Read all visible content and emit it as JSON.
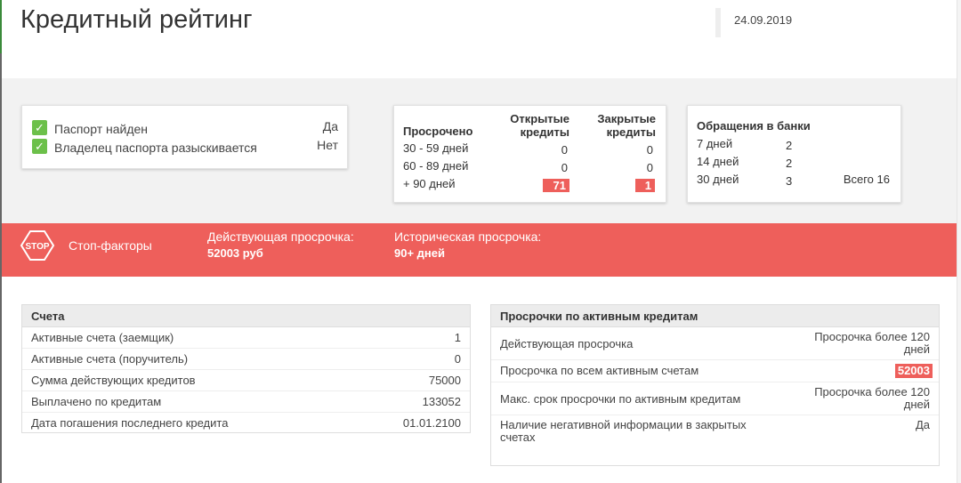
{
  "header": {
    "title": "Кредитный рейтинг",
    "date": "24.09.2019"
  },
  "passport": [
    {
      "label": "Паспорт найден",
      "value": "Да"
    },
    {
      "label": "Владелец паспорта разыскивается",
      "value": "Нет"
    }
  ],
  "overdue": {
    "title": "Просрочено",
    "col_open": "Открытые кредиты",
    "col_closed": "Закрытые кредиты",
    "rows": [
      {
        "label": "30 - 59 дней",
        "open": "0",
        "closed": "0"
      },
      {
        "label": "60 - 89 дней",
        "open": "0",
        "closed": "0"
      },
      {
        "label": "+ 90 дней",
        "open": "71",
        "closed": "1"
      }
    ]
  },
  "requests": {
    "title": "Обращения в банки",
    "rows": [
      {
        "label": "7 дней",
        "value": "2"
      },
      {
        "label": "14 дней",
        "value": "2"
      },
      {
        "label": "30 дней",
        "value": "3"
      }
    ],
    "total": "Всего 16"
  },
  "stop": {
    "icon_text": "STOP",
    "label": "Стоп-факторы",
    "current_label": "Действующая просрочка:",
    "current_value": "52003 руб",
    "hist_label": "Историческая просрочка:",
    "hist_value": "90+ дней"
  },
  "accounts": {
    "title": "Счета",
    "rows": [
      {
        "label": "Активные счета (заемщик)",
        "value": "1"
      },
      {
        "label": "Активные счета (поручитель)",
        "value": "0"
      },
      {
        "label": "Сумма действующих кредитов",
        "value": "75000"
      },
      {
        "label": "Выплачено по кредитам",
        "value": "133052"
      },
      {
        "label": "Дата погашения последнего кредита",
        "value": "01.01.2100"
      }
    ]
  },
  "active_overdue": {
    "title": "Просрочки по активным кредитам",
    "rows": [
      {
        "label": "Действующая просрочка",
        "value": "Просрочка более 120 дней"
      },
      {
        "label": "Просрочка по всем активным счетам",
        "value": "52003"
      },
      {
        "label": "Макс. срок просрочки по активным кредитам",
        "value": "Просрочка более 120 дней"
      },
      {
        "label": "Наличие негативной информации в закрытых счетах",
        "value": "Да"
      }
    ]
  }
}
